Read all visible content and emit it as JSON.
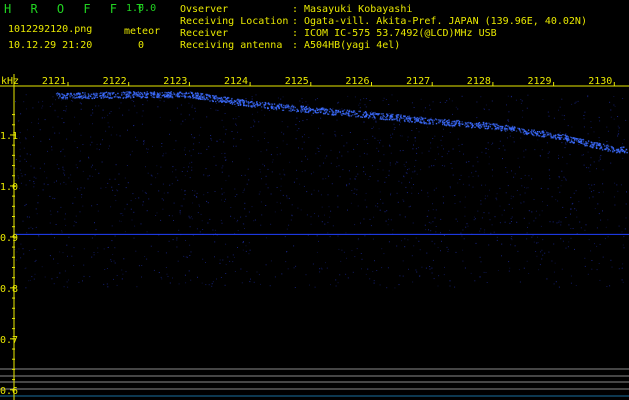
{
  "app": {
    "name": "H R O F F T",
    "version": "1.0.0"
  },
  "file": {
    "name": "1012292120.png",
    "datetime": "10.12.29 21:20"
  },
  "meteor": {
    "label": "meteor",
    "count": "0"
  },
  "info": [
    {
      "label": "Ovserver",
      "value": "Masayuki Kobayashi"
    },
    {
      "label": "Receiving Location",
      "value": "Ogata-vill. Akita-Pref. JAPAN (139.96E, 40.02N)"
    },
    {
      "label": "Receiver",
      "value": "ICOM IC-575 53.7492(@LCD)MHz USB"
    },
    {
      "label": "Receiving antenna",
      "value": "A504HB(yagi 4el)"
    }
  ],
  "colors": {
    "header_green": "#21d321",
    "header_yellow": "#e8e800",
    "axis_yellow": "#e8e800",
    "signal_blue": "#3c6cff"
  },
  "chart_data": {
    "type": "heatmap",
    "ylabel": "kHz",
    "xlabel": "",
    "x_ticks": [
      "2121",
      "2122",
      "2123",
      "2124",
      "2125",
      "2126",
      "2127",
      "2128",
      "2129",
      "2130"
    ],
    "y_ticks": [
      "1.1",
      "1.0",
      "0.9",
      "0.8",
      "0.7",
      "0.6"
    ],
    "ylim": [
      0.58,
      1.2
    ],
    "series": [
      {
        "values": [
          {
            "x": 2121,
            "y": 1.178
          },
          {
            "x": 2122,
            "y": 1.18
          },
          {
            "x": 2123,
            "y": 1.18
          },
          {
            "x": 2124,
            "y": 1.162
          },
          {
            "x": 2125,
            "y": 1.15
          },
          {
            "x": 2126,
            "y": 1.14
          },
          {
            "x": 2127,
            "y": 1.128
          },
          {
            "x": 2128,
            "y": 1.118
          },
          {
            "x": 2129,
            "y": 1.1
          },
          {
            "x": 2130,
            "y": 1.072
          }
        ]
      }
    ],
    "horizontal_lines": [
      {
        "y": 0.905,
        "color": "#2040ff"
      }
    ],
    "grid": false
  }
}
